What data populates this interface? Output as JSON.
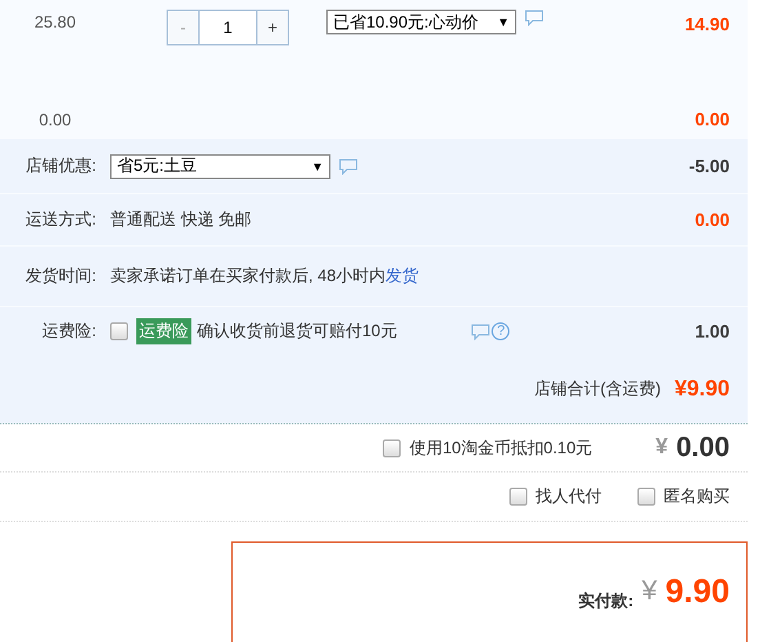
{
  "item": {
    "unit_price": "25.80",
    "quantity": {
      "minus": "-",
      "value": "1",
      "plus": "+"
    },
    "promo": {
      "value": "已省10.90元:心动价",
      "arrow": "▼"
    },
    "subtotal": "14.90"
  },
  "extra_row": {
    "unit_price": "0.00",
    "subtotal": "0.00"
  },
  "fields": [
    {
      "kind": "select",
      "label": "店铺优惠:",
      "value": "省5元:土豆",
      "arrow": "▼",
      "amount": "-5.00",
      "highlight": false
    },
    {
      "kind": "text",
      "label": "运送方式:",
      "text": "普通配送 快递 免邮",
      "amount": "0.00",
      "highlight": true
    },
    {
      "kind": "link",
      "label": "发货时间:",
      "text": "卖家承诺订单在买家付款后, 48小时内",
      "link": "发货"
    },
    {
      "kind": "checkbox",
      "label": "运费险:",
      "checked": false,
      "tag": "运费险",
      "text": "确认收货前退货可赔付10元",
      "help": "?",
      "amount": "1.00",
      "highlight": false
    }
  ],
  "shop_total": {
    "label": "店铺合计(含运费)",
    "amount": "¥9.90"
  },
  "coins": {
    "checked": false,
    "label": "使用10淘金币抵扣0.10元",
    "currency": "¥",
    "amount": "0.00"
  },
  "options": [
    {
      "label": "找人代付",
      "checked": false
    },
    {
      "label": "匿名购买",
      "checked": false
    }
  ],
  "payment": {
    "label": "实付款:",
    "currency": "¥",
    "amount": "9.90"
  }
}
